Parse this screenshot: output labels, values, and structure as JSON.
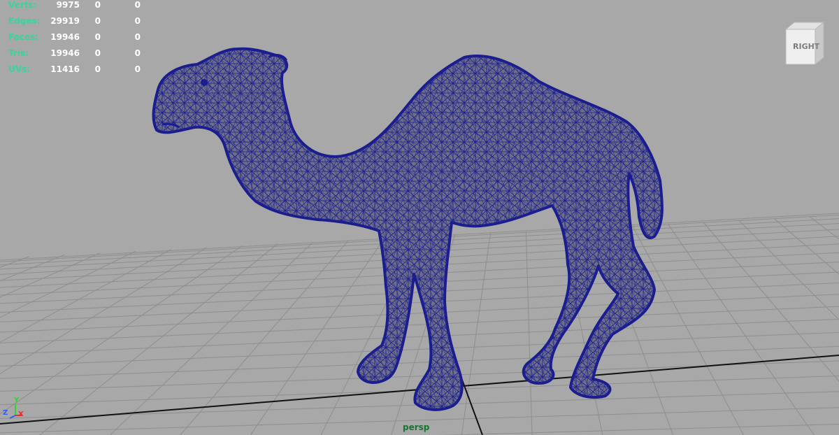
{
  "hud": {
    "rows": [
      {
        "label": "Verts:",
        "values": [
          "9975",
          "0",
          "0"
        ]
      },
      {
        "label": "Edges:",
        "values": [
          "29919",
          "0",
          "0"
        ]
      },
      {
        "label": "Faces:",
        "values": [
          "19946",
          "0",
          "0"
        ]
      },
      {
        "label": "Tris:",
        "values": [
          "19946",
          "0",
          "0"
        ]
      },
      {
        "label": "UVs:",
        "values": [
          "11416",
          "0",
          "0"
        ]
      }
    ],
    "label_color": "#37d59a",
    "value_color": "#ffffff"
  },
  "view_cube": {
    "label": "RIGHT"
  },
  "camera": {
    "label": "persp"
  },
  "axis_indicator": {
    "y": "Y",
    "z": "Z",
    "x": "X"
  },
  "colors": {
    "background": "#a8a8a8",
    "grid": "#8e8e8e",
    "grid_axis": "#111111",
    "wireframe": "#1b1d8f",
    "mesh_fill": "#6f7086"
  }
}
